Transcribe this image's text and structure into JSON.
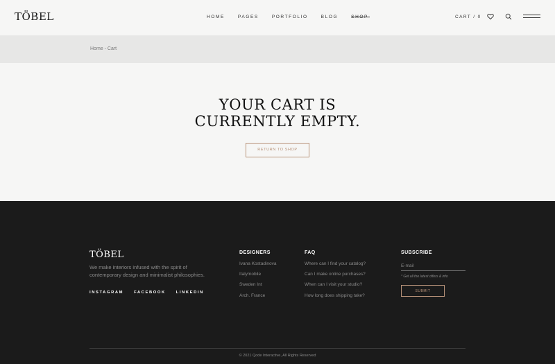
{
  "brand": {
    "logo": "TÖBEL"
  },
  "nav": {
    "items": [
      {
        "label": "HOME"
      },
      {
        "label": "PAGES"
      },
      {
        "label": "PORTFOLIO"
      },
      {
        "label": "BLOG"
      },
      {
        "label": "SHOP"
      }
    ],
    "cart_label": "CART / 0",
    "icons": [
      "heart-icon",
      "search-icon",
      "menu-icon"
    ]
  },
  "breadcrumb": {
    "text": "Home - Cart"
  },
  "main": {
    "title_line1": "YOUR CART IS",
    "title_line2": "CURRENTLY EMPTY.",
    "return_button": "RETURN TO SHOP"
  },
  "footer": {
    "logo": "TÖBEL",
    "tagline": "We make interiors infused with the spirit of contemporary design and minimalist philosophies.",
    "socials": [
      "INSTAGRAM",
      "FACEBOOK",
      "LINKEDIN"
    ],
    "designers": {
      "title": "DESIGNERS",
      "items": [
        "Ivana Kostadinova",
        "Italymobile",
        "Sweden Int",
        "Arch. France"
      ]
    },
    "faq": {
      "title": "FAQ",
      "items": [
        "Where can I find your catalog?",
        "Can I make online purchases?",
        "When can I visit your studio?",
        "How long does shipping take?"
      ]
    },
    "subscribe": {
      "title": "SUBSCRIBE",
      "email_placeholder": "E-mail",
      "note": "* Get all the latest offers & info",
      "submit_label": "SUBMIT"
    },
    "copyright": "© 2021 Qode Interactive, All Rights Reserved"
  },
  "colors": {
    "accent": "#b8937a",
    "footer_bg": "#1b1b1b",
    "page_bg": "#f6f6f5",
    "breadcrumb_bg": "#e7e7e6"
  }
}
